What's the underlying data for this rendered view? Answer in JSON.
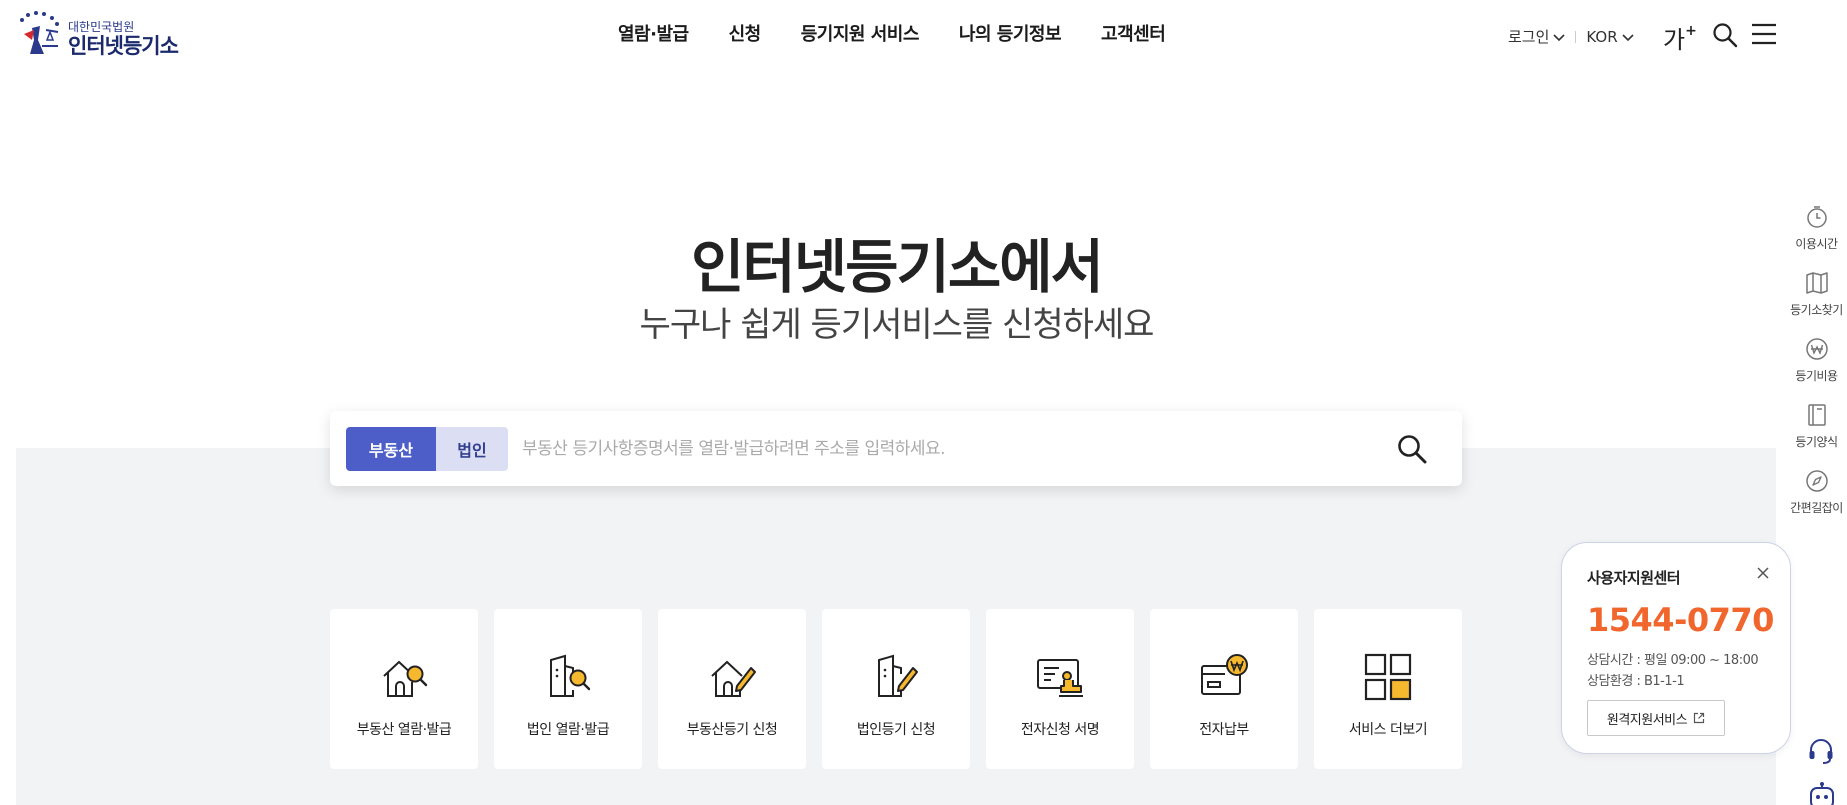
{
  "logo": {
    "sub": "대한민국법원",
    "main": "인터넷등기소"
  },
  "gnb": [
    "열람·발급",
    "신청",
    "등기지원 서비스",
    "나의 등기정보",
    "고객센터"
  ],
  "util": {
    "login": "로그인",
    "lang": "KOR",
    "font_size": "가",
    "font_plus": "+"
  },
  "hero": {
    "title": "인터넷등기소에서",
    "subtitle": "누구나 쉽게 등기서비스를 신청하세요"
  },
  "search": {
    "tabs": [
      "부동산",
      "법인"
    ],
    "active_tab": "부동산",
    "placeholder": "부동산 등기사항증명서를 열람·발급하려면 주소를 입력하세요."
  },
  "services": [
    {
      "label": "부동산 열람·발급",
      "icon": "house-search-icon"
    },
    {
      "label": "법인 열람·발급",
      "icon": "building-search-icon"
    },
    {
      "label": "부동산등기 신청",
      "icon": "house-edit-icon"
    },
    {
      "label": "법인등기 신청",
      "icon": "building-edit-icon"
    },
    {
      "label": "전자신청 서명",
      "icon": "e-sign-icon"
    },
    {
      "label": "전자납부",
      "icon": "e-payment-icon"
    },
    {
      "label": "서비스 더보기",
      "icon": "more-grid-icon"
    }
  ],
  "quick_menu": [
    {
      "label": "이용시간",
      "icon": "clock-icon"
    },
    {
      "label": "등기소찾기",
      "icon": "map-icon"
    },
    {
      "label": "등기비용",
      "icon": "won-coin-icon"
    },
    {
      "label": "등기양식",
      "icon": "book-icon"
    },
    {
      "label": "간편길잡이",
      "icon": "compass-icon"
    }
  ],
  "support": {
    "title": "사용자지원센터",
    "phone": "1544-0770",
    "hours": "상담시간 : 평일 09:00 ~ 18:00",
    "env": "상담환경 : B1-1-1",
    "remote_button": "원격지원서비스"
  },
  "colors": {
    "brand": "#4d5ec8",
    "brand_light": "#dcdff3",
    "accent": "#f0662c",
    "band": "#f2f3f5",
    "icon_yellow": "#f5b82e"
  }
}
